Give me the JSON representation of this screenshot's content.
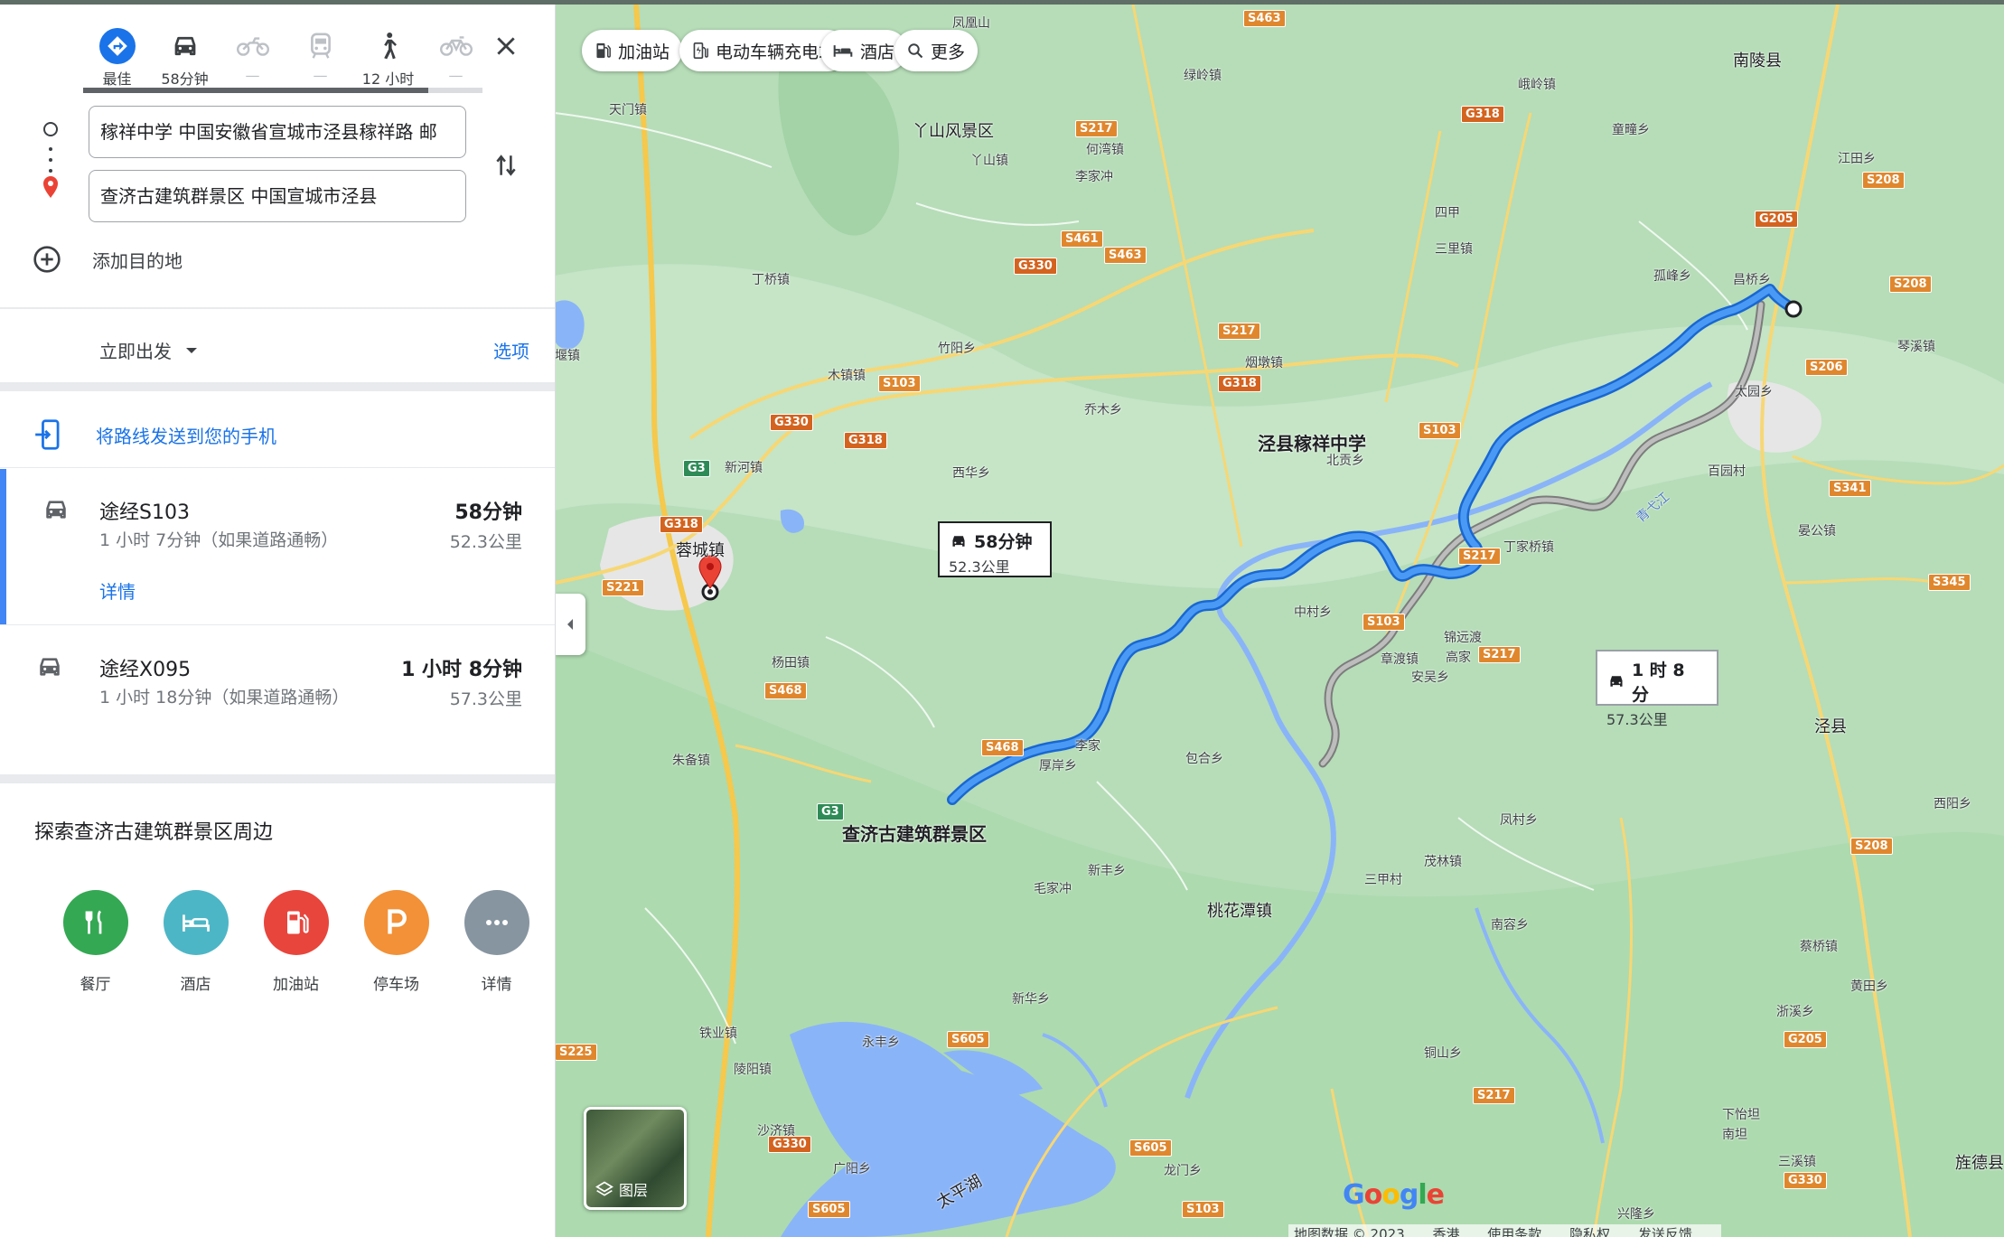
{
  "modes": [
    {
      "key": "best",
      "label": "最佳",
      "icon": "directions-icon"
    },
    {
      "key": "car",
      "label": "58分钟",
      "icon": "car-icon"
    },
    {
      "key": "moto",
      "label": "—",
      "icon": "motorcycle-icon"
    },
    {
      "key": "transit",
      "label": "—",
      "icon": "train-icon"
    },
    {
      "key": "walk",
      "label": "12 小时",
      "icon": "walk-icon"
    },
    {
      "key": "bike",
      "label": "—",
      "icon": "bicycle-icon"
    }
  ],
  "origin": "稼祥中学 中国安徽省宣城市泾县稼祥路 邮",
  "destination": "查济古建筑群景区 中国宣城市泾县",
  "add_destination": "添加目的地",
  "depart": {
    "label": "立即出发",
    "options": "选项"
  },
  "send_to_phone": "将路线发送到您的手机",
  "routes": [
    {
      "name": "途经S103",
      "duration": "58分钟",
      "sub": "1 小时 7分钟（如果道路通畅）",
      "distance": "52.3公里",
      "details": "详情"
    },
    {
      "name": "途经X095",
      "duration": "1 小时 8分钟",
      "sub": "1 小时 18分钟（如果道路通畅）",
      "distance": "57.3公里"
    }
  ],
  "explore": {
    "title": "探索查济古建筑群景区周边",
    "categories": [
      {
        "label": "餐厅",
        "color": "#34a853",
        "icon": "restaurant-icon"
      },
      {
        "label": "酒店",
        "color": "#4db6c6",
        "icon": "hotel-icon"
      },
      {
        "label": "加油站",
        "color": "#e8453c",
        "icon": "gas-icon"
      },
      {
        "label": "停车场",
        "color": "#f29137",
        "icon": "parking-icon"
      },
      {
        "label": "详情",
        "color": "#8795a1",
        "icon": "more-icon"
      }
    ]
  },
  "chips": [
    "加油站",
    "电动车辆充电站",
    "酒店",
    "更多"
  ],
  "map": {
    "origin_label": "泾县稼祥中学",
    "destination_label": "查济古建筑群景区",
    "callout_main": {
      "time": "58分钟",
      "dist": "52.3公里"
    },
    "callout_alt": {
      "time": "1 时 8 分",
      "dist": "57.3公里"
    },
    "layers": "图层",
    "places": {
      "yashan": "丫山风景区",
      "rongcheng": "蓉城镇",
      "taohuatan": "桃花潭镇",
      "jingxian": "泾县",
      "nanling": "南陵县",
      "jingde": "旌德县",
      "taipinghu": "太平湖",
      "fenghuangshan": "凤凰山",
      "lvling": "绿岭镇",
      "yashanzhen": "丫山镇",
      "hexi": "何湾镇",
      "lijiachong": "李家冲",
      "tianmen": "天门镇",
      "dingqiao": "丁桥镇",
      "yanzhen": "堰镇",
      "zhuyang": "竹阳乡",
      "mujing": "木镇镇",
      "qiaomu": "乔木乡",
      "yantun": "烟墩镇",
      "sanli": "三里镇",
      "sijia": "四甲",
      "eling": "峨岭镇",
      "tongtong": "童疃乡",
      "gudun": "孤峰乡",
      "changqiao": "昌桥乡",
      "qinxi": "琴溪镇",
      "taiyuan": "太园乡",
      "baitian": "百园村",
      "yanggong": "晏公镇",
      "dingjiaqiao": "丁家桥镇",
      "beigong": "北贡乡",
      "zhongcun": "中村乡",
      "xinhe": "新河镇",
      "xihua": "西华乡",
      "yangtian": "杨田镇",
      "zhubei": "朱备镇",
      "houanxiang": "厚岸乡",
      "lijia": "李家",
      "baohe": "包合乡",
      "jinyuan": "锦远渡",
      "zhangdu": "章渡镇",
      "anxi": "安吴乡",
      "gaojia": "高家",
      "fengcun": "凤村乡",
      "maolin": "茂林镇",
      "sanyecun": "三甲村",
      "nanrong": "南容乡",
      "xinfeng": "新丰乡",
      "maojiachong": "毛家冲",
      "xinhuaxiang": "新华乡",
      "yongfeng": "永丰乡",
      "tieyun": "铁业镇",
      "lingyang": "陵阳镇",
      "shazhou": "沙济镇",
      "guangyang": "广阳乡",
      "longmen": "龙门乡",
      "tongshan": "铜山乡",
      "xinglong": "兴隆乡",
      "zhexi": "浙溪乡",
      "huangtian": "黄田乡",
      "xiaping": "下怡坦",
      "nanlang": "南坦",
      "sanxi": "三溪镇",
      "caiqiao": "蔡桥镇",
      "xicun": "西阳乡",
      "jiangtian": "江田乡",
      "qingyi": "青弋江"
    },
    "footer": [
      "地图数据 © 2023",
      "香港",
      "使用条款",
      "隐私权",
      "发送反馈"
    ]
  },
  "colors": {
    "route": "#1a73e8",
    "alt_route": "#9e9e9e",
    "accent": "#1a73e8"
  }
}
